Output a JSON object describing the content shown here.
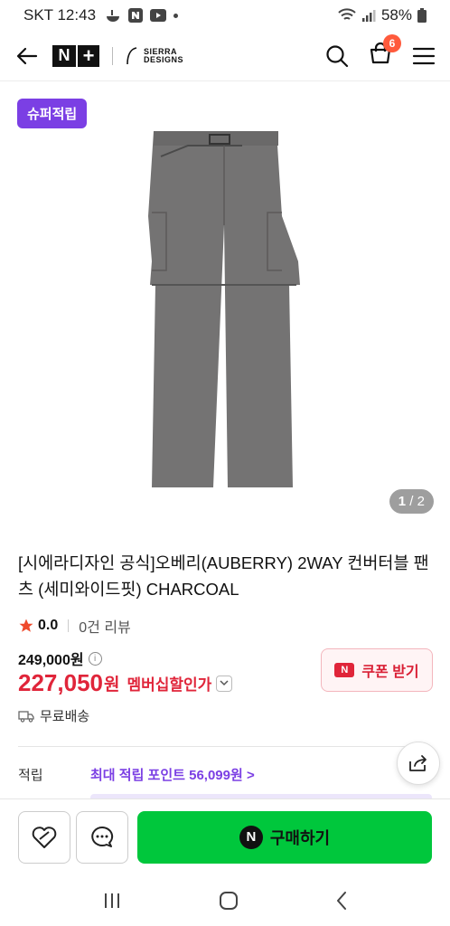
{
  "status_bar": {
    "carrier_time": "SKT 12:43",
    "battery": "58%"
  },
  "header": {
    "logo_np": [
      "N",
      "+"
    ],
    "logo_sierra_line1": "SIERRA",
    "logo_sierra_line2": "DESIGNS",
    "cart_count": "6"
  },
  "gallery": {
    "badge": "슈퍼적립",
    "page_current": "1",
    "page_sep": " / ",
    "page_total": "2"
  },
  "product": {
    "title": "[시에라디자인 공식]오베리(AUBERRY) 2WAY 컨버터블 팬츠 (세미와이드핏) CHARCOAL",
    "rating": "0.0",
    "review_count": "0건 리뷰",
    "original_price": "249,000원",
    "sale_price": "227,050",
    "sale_currency": "원",
    "member_label": "멤버십할인가",
    "coupon_label": "쿠폰 받기",
    "coupon_icon": "N",
    "shipping": "무료배송",
    "points_label": "적립",
    "points_value": "최대 적립 포인트 56,099원 >"
  },
  "bottom_bar": {
    "buy_label": "구매하기",
    "buy_icon": "N"
  },
  "colors": {
    "accent_purple": "#7b3fe4",
    "sale_red": "#e0253a",
    "buy_green": "#00c73c",
    "badge_orange": "#ff5a3c"
  }
}
